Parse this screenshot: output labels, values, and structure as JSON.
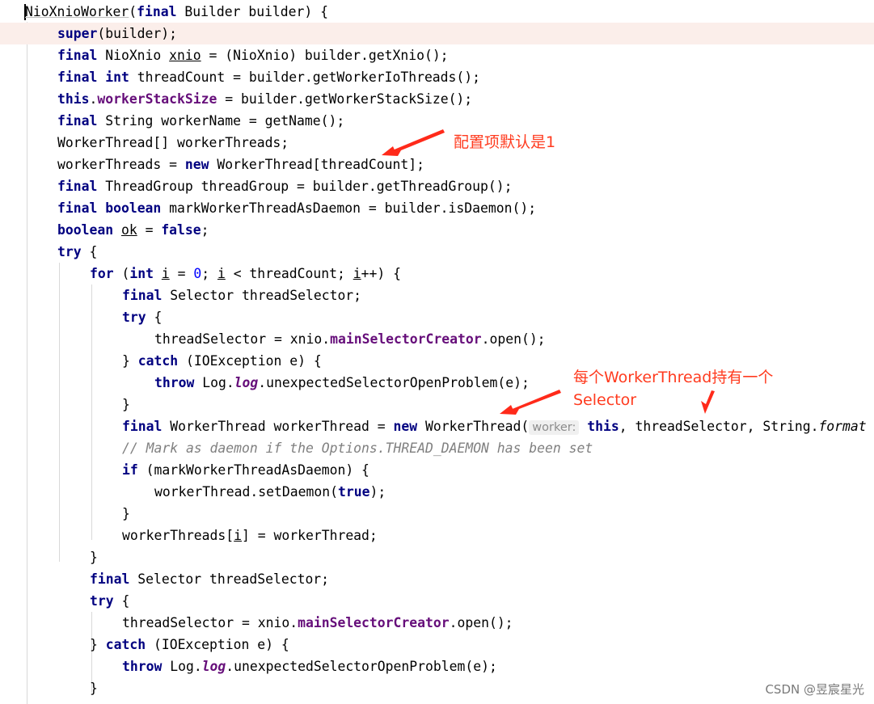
{
  "code": {
    "l1": [
      "NioXnioWorker",
      "(",
      "final",
      " Builder builder) {"
    ],
    "l2": [
      "super",
      "(builder);"
    ],
    "l3": [
      "final",
      " NioXnio ",
      "xnio",
      " = (NioXnio) builder.getXnio();"
    ],
    "l4": [
      "final",
      " ",
      "int",
      " threadCount = builder.getWorkerIoThreads();"
    ],
    "l5": [
      "this",
      ".",
      "workerStackSize",
      " = builder.getWorkerStackSize();"
    ],
    "l6": [
      "final",
      " String workerName = getName();"
    ],
    "l7": [
      "WorkerThread[] workerThreads;"
    ],
    "l8": [
      "workerThreads = ",
      "new",
      " WorkerThread[threadCount];"
    ],
    "l9": [
      "final",
      " ThreadGroup threadGroup = builder.getThreadGroup();"
    ],
    "l10": [
      "final",
      " ",
      "boolean",
      " markWorkerThreadAsDaemon = builder.isDaemon();"
    ],
    "l11": [
      "boolean",
      " ",
      "ok",
      " = ",
      "false",
      ";"
    ],
    "l12": [
      "try",
      " {"
    ],
    "l13": [
      "for",
      " (",
      "int",
      " ",
      "i",
      " = ",
      "0",
      "; ",
      "i",
      " < threadCount; ",
      "i",
      "++) {"
    ],
    "l14": [
      "final",
      " Selector threadSelector;"
    ],
    "l15": [
      "try",
      " {"
    ],
    "l16": [
      "threadSelector = xnio.",
      "mainSelectorCreator",
      ".open();"
    ],
    "l17": [
      "} ",
      "catch",
      " (IOException e) {"
    ],
    "l18": [
      "throw",
      " Log.",
      "log",
      ".unexpectedSelectorOpenProblem(e);"
    ],
    "l19": [
      "}"
    ],
    "l20": [
      "final",
      " WorkerThread workerThread = ",
      "new",
      " WorkerThread(",
      "worker:",
      " ",
      "this",
      ", threadSelector, String.",
      "format"
    ],
    "l21": [
      "// Mark as daemon if the Options.THREAD_DAEMON has been set"
    ],
    "l22": [
      "if",
      " (markWorkerThreadAsDaemon) {"
    ],
    "l23": [
      "workerThread.setDaemon(",
      "true",
      ");"
    ],
    "l24": [
      "}"
    ],
    "l25": [
      "workerThreads[",
      "i",
      "] = workerThread;"
    ],
    "l26": [
      "}"
    ],
    "l27": [
      "final",
      " Selector threadSelector;"
    ],
    "l28": [
      "try",
      " {"
    ],
    "l29": [
      "threadSelector = xnio.",
      "mainSelectorCreator",
      ".open();"
    ],
    "l30": [
      "} ",
      "catch",
      " (IOException e) {"
    ],
    "l31": [
      "throw",
      " Log.",
      "log",
      ".unexpectedSelectorOpenProblem(e);"
    ],
    "l32": [
      "}"
    ]
  },
  "annotations": {
    "note1": "配置项默认是1",
    "note2_line1": "每个WorkerThread持有一个",
    "note2_line2": "Selector"
  },
  "colors": {
    "annotation": "#ff3b1f",
    "keyword": "#000080",
    "field": "#660e7a",
    "number": "#0000ff",
    "comment": "#808080",
    "current_line": "#fbeeea"
  },
  "watermark": "CSDN @昱宸星光"
}
